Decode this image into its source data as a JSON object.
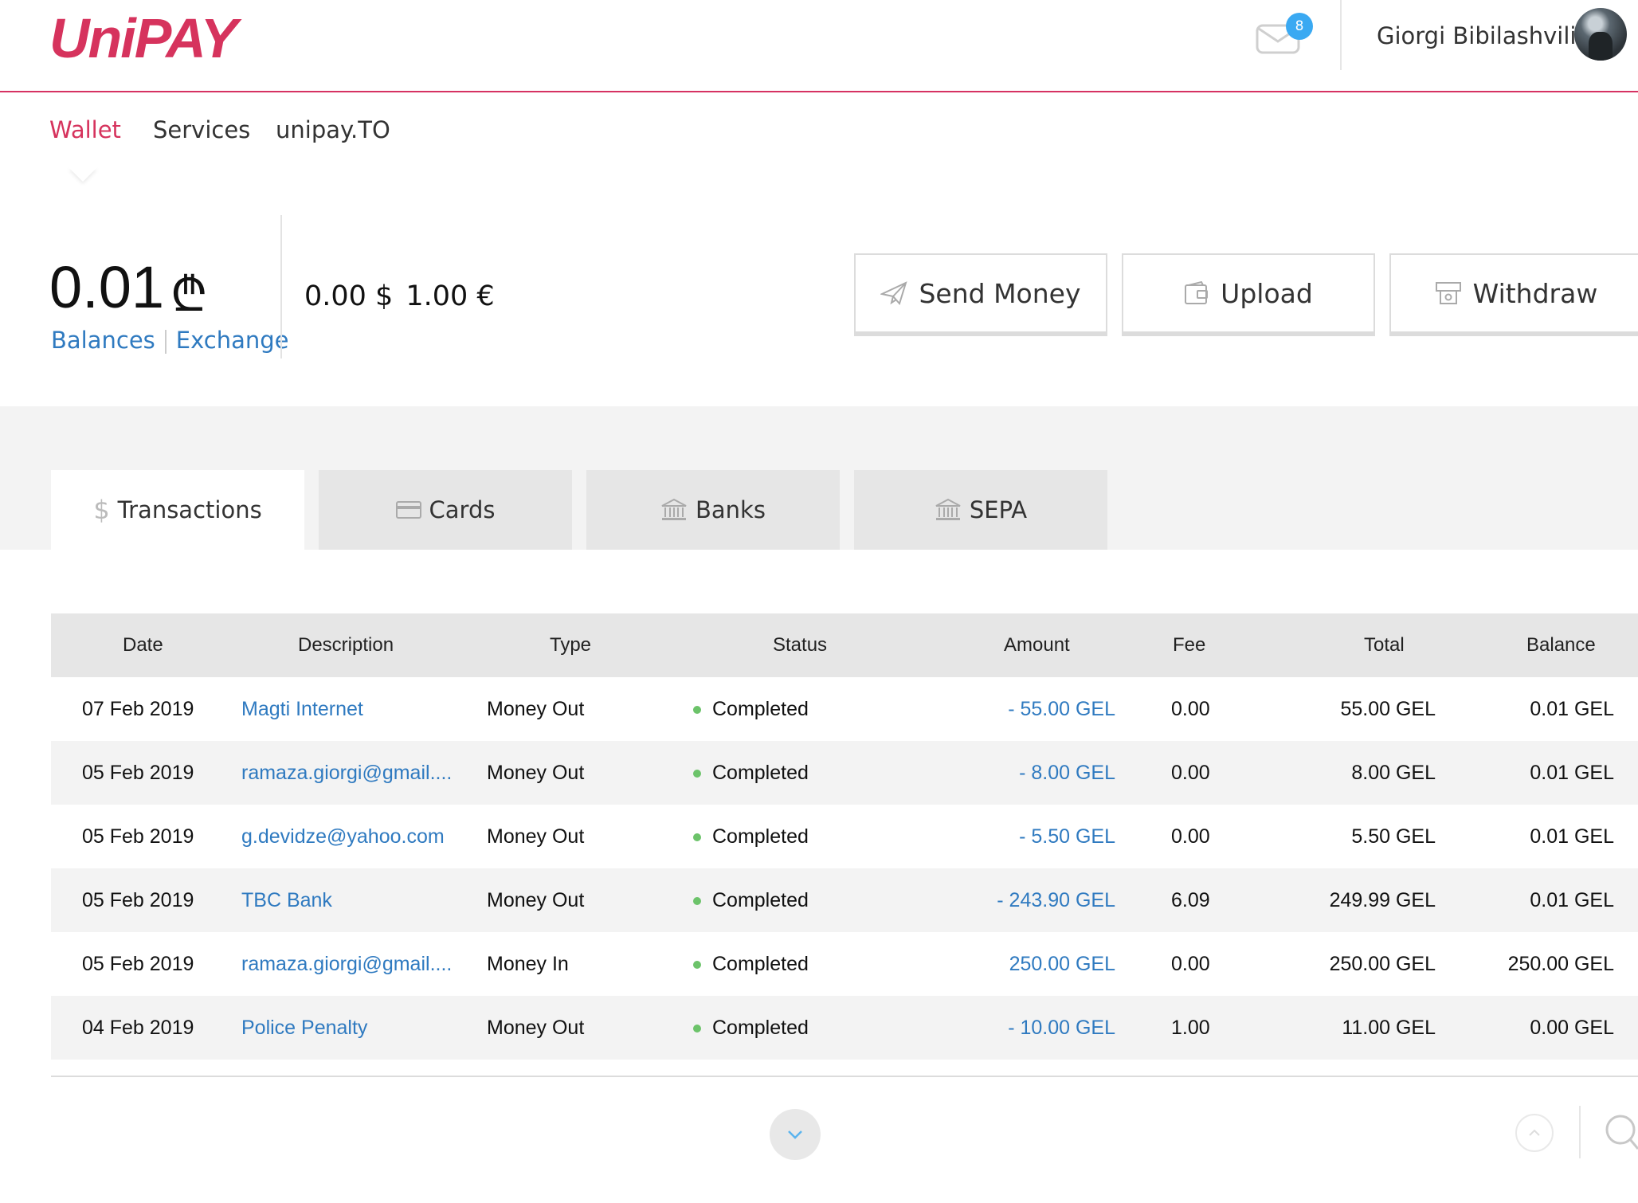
{
  "header": {
    "logo": "UniPAY",
    "mail_count": "8",
    "user_name": "Giorgi Bibilashvili"
  },
  "nav": [
    {
      "label": "Wallet",
      "active": true
    },
    {
      "label": "Services",
      "active": false
    },
    {
      "label": "unipay.TO",
      "active": false
    }
  ],
  "balance": {
    "amount": "0.01",
    "currency_symbol": "₾",
    "link_balances": "Balances",
    "link_exchange": "Exchange",
    "usd": "0.00 $",
    "eur": "1.00 €"
  },
  "actions": {
    "send": "Send Money",
    "upload": "Upload",
    "withdraw": "Withdraw"
  },
  "tabs": [
    {
      "label": "Transactions",
      "icon": "dollar-icon",
      "active": true
    },
    {
      "label": "Cards",
      "icon": "card-icon",
      "active": false
    },
    {
      "label": "Banks",
      "icon": "bank-icon",
      "active": false
    },
    {
      "label": "SEPA",
      "icon": "bank-icon",
      "active": false
    }
  ],
  "table": {
    "columns": [
      "Date",
      "Description",
      "Type",
      "Status",
      "Amount",
      "Fee",
      "Total",
      "Balance"
    ],
    "rows": [
      {
        "date": "07 Feb 2019",
        "description": "Magti Internet",
        "type": "Money Out",
        "status": "Completed",
        "amount": "- 55.00 GEL",
        "fee": "0.00",
        "total": "55.00 GEL",
        "balance": "0.01 GEL"
      },
      {
        "date": "05 Feb 2019",
        "description": "ramaza.giorgi@gmail....",
        "type": "Money Out",
        "status": "Completed",
        "amount": "- 8.00 GEL",
        "fee": "0.00",
        "total": "8.00 GEL",
        "balance": "0.01 GEL"
      },
      {
        "date": "05 Feb 2019",
        "description": "g.devidze@yahoo.com",
        "type": "Money Out",
        "status": "Completed",
        "amount": "- 5.50 GEL",
        "fee": "0.00",
        "total": "5.50 GEL",
        "balance": "0.01 GEL"
      },
      {
        "date": "05 Feb 2019",
        "description": "TBC Bank",
        "type": "Money Out",
        "status": "Completed",
        "amount": "- 243.90 GEL",
        "fee": "6.09",
        "total": "249.99 GEL",
        "balance": "0.01 GEL"
      },
      {
        "date": "05 Feb 2019",
        "description": "ramaza.giorgi@gmail....",
        "type": "Money In",
        "status": "Completed",
        "amount": "250.00 GEL",
        "fee": "0.00",
        "total": "250.00 GEL",
        "balance": "250.00 GEL"
      },
      {
        "date": "04 Feb 2019",
        "description": "Police Penalty",
        "type": "Money Out",
        "status": "Completed",
        "amount": "- 10.00 GEL",
        "fee": "1.00",
        "total": "11.00 GEL",
        "balance": "0.00 GEL"
      }
    ]
  },
  "colors": {
    "brand": "#d6335d",
    "link": "#2f7ac0",
    "status_completed": "#6cc36a",
    "badge": "#3aa9f2"
  }
}
